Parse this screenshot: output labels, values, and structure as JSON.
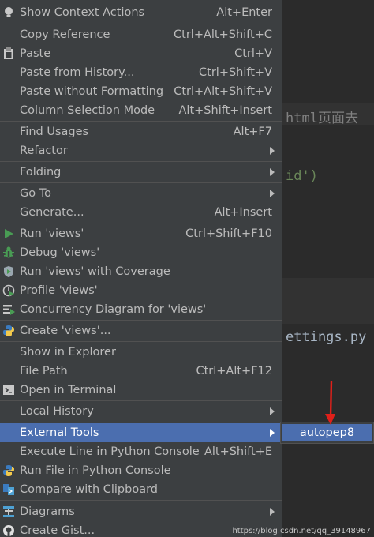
{
  "editor": {
    "lines": [
      {
        "text": "html页面去",
        "kind": "cmt"
      },
      {
        "text": "id')",
        "kind": "str"
      },
      {
        "text": "ettings.py",
        "kind": "plain"
      }
    ]
  },
  "menu": {
    "items": [
      {
        "label": "Show Context Actions",
        "shortcut": "Alt+Enter",
        "icon": "lightbulb-icon"
      },
      {
        "label": "Copy Reference",
        "shortcut": "Ctrl+Alt+Shift+C",
        "icon": ""
      },
      {
        "label": "Paste",
        "shortcut": "Ctrl+V",
        "icon": "clipboard-icon"
      },
      {
        "label": "Paste from History...",
        "shortcut": "Ctrl+Shift+V",
        "icon": ""
      },
      {
        "label": "Paste without Formatting",
        "shortcut": "Ctrl+Alt+Shift+V",
        "icon": ""
      },
      {
        "label": "Column Selection Mode",
        "shortcut": "Alt+Shift+Insert",
        "icon": ""
      },
      {
        "label": "Find Usages",
        "shortcut": "Alt+F7",
        "icon": ""
      },
      {
        "label": "Refactor",
        "shortcut": "",
        "icon": "",
        "submenu": true
      },
      {
        "label": "Folding",
        "shortcut": "",
        "icon": "",
        "submenu": true
      },
      {
        "label": "Go To",
        "shortcut": "",
        "icon": "",
        "submenu": true
      },
      {
        "label": "Generate...",
        "shortcut": "Alt+Insert",
        "icon": ""
      },
      {
        "label": "Run 'views'",
        "shortcut": "Ctrl+Shift+F10",
        "icon": "run-icon"
      },
      {
        "label": "Debug 'views'",
        "shortcut": "",
        "icon": "debug-icon"
      },
      {
        "label": "Run 'views' with Coverage",
        "shortcut": "",
        "icon": "coverage-icon"
      },
      {
        "label": "Profile 'views'",
        "shortcut": "",
        "icon": "profile-icon"
      },
      {
        "label": "Concurrency Diagram for 'views'",
        "shortcut": "",
        "icon": "concurrency-icon"
      },
      {
        "label": "Create 'views'...",
        "shortcut": "",
        "icon": "python-icon"
      },
      {
        "label": "Show in Explorer",
        "shortcut": "",
        "icon": ""
      },
      {
        "label": "File Path",
        "shortcut": "Ctrl+Alt+F12",
        "icon": ""
      },
      {
        "label": "Open in Terminal",
        "shortcut": "",
        "icon": "terminal-icon"
      },
      {
        "label": "Local History",
        "shortcut": "",
        "icon": "",
        "submenu": true
      },
      {
        "label": "External Tools",
        "shortcut": "",
        "icon": "",
        "submenu": true,
        "selected": true
      },
      {
        "label": "Execute Line in Python Console",
        "shortcut": "Alt+Shift+E",
        "icon": ""
      },
      {
        "label": "Run File in Python Console",
        "shortcut": "",
        "icon": "python-icon"
      },
      {
        "label": "Compare with Clipboard",
        "shortcut": "",
        "icon": "compare-icon"
      },
      {
        "label": "Diagrams",
        "shortcut": "",
        "icon": "diagram-icon",
        "submenu": true
      },
      {
        "label": "Create Gist...",
        "shortcut": "",
        "icon": "github-icon"
      }
    ]
  },
  "submenu": {
    "items": [
      {
        "label": "autopep8"
      }
    ]
  },
  "colors": {
    "menu_bg": "#3c3f41",
    "selection": "#4b6eaf",
    "annotation": "#e0201a"
  },
  "watermark": "https://blog.csdn.net/qq_39148967"
}
